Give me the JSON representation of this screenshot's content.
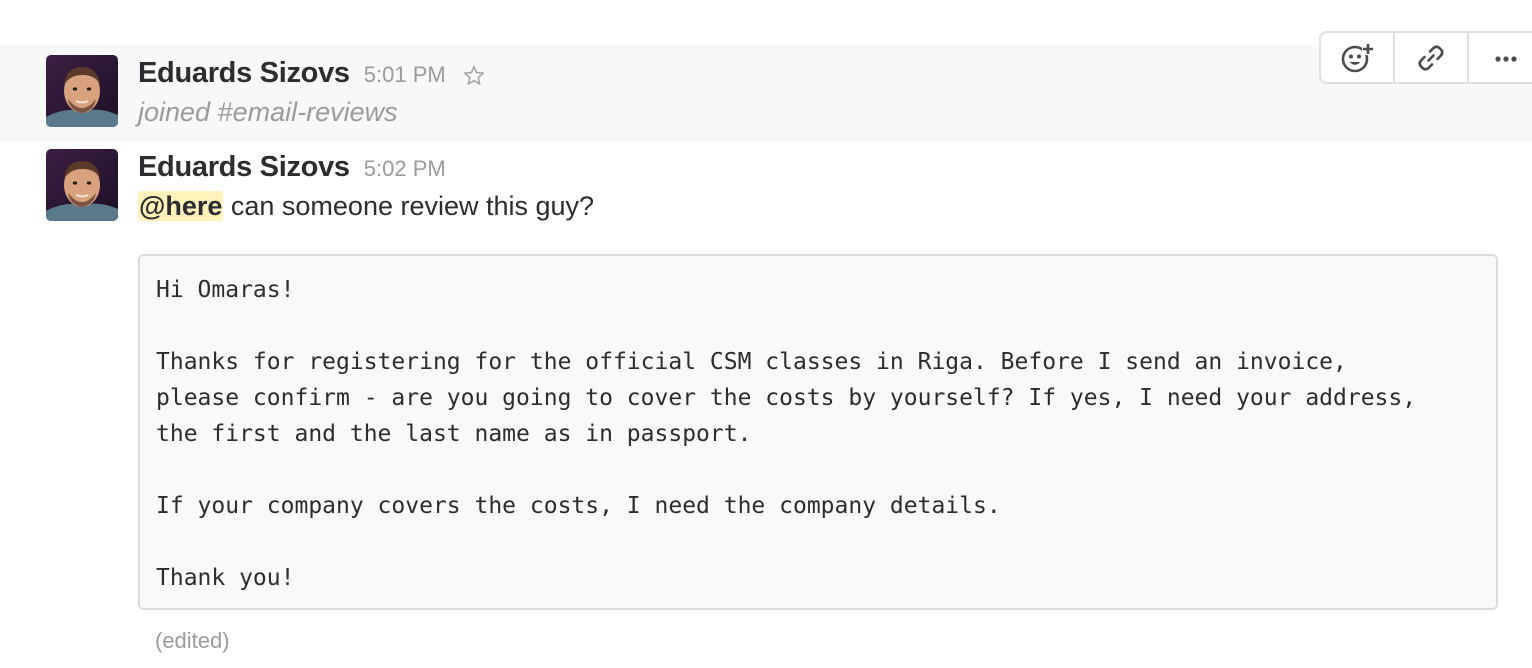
{
  "messages": [
    {
      "sender": "Eduards Sizovs",
      "time": "5:01 PM",
      "text": "joined #email-reviews"
    },
    {
      "sender": "Eduards Sizovs",
      "time": "5:02 PM",
      "mention": "@here",
      "text": " can someone review this guy?",
      "code_block": "Hi Omaras!\n\nThanks for registering for the official CSM classes in Riga. Before I send an invoice,\nplease confirm - are you going to cover the costs by yourself? If yes, I need your address,\nthe first and the last name as in passport.\n\nIf your company covers the costs, I need the company details.\n\nThank you!",
      "edited_label": "(edited)"
    }
  ],
  "message_actions": {
    "icons": [
      "add-reaction-icon",
      "link-icon",
      "more-actions-icon"
    ]
  },
  "colors": {
    "hover_background": "#f8f8f8",
    "mention_highlight": "#fff2bb",
    "muted_text": "#9a9b9e",
    "primary_text": "#2c2d30"
  }
}
